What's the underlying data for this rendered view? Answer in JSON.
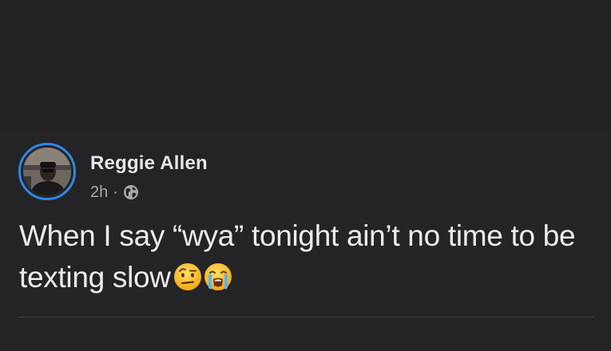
{
  "post": {
    "author": "Reggie Allen",
    "time": "2h",
    "separator": "·",
    "privacy_icon": "globe-icon",
    "text": "When I say “wya”  tonight ain’t no time to be texting slow",
    "emojis": [
      "raised-eyebrow-emoji",
      "loudly-crying-emoji"
    ]
  },
  "colors": {
    "background": "#242426",
    "avatar_ring": "#2f86e8",
    "name_text": "#e6e6e8",
    "meta_text": "#a8a8ac"
  }
}
